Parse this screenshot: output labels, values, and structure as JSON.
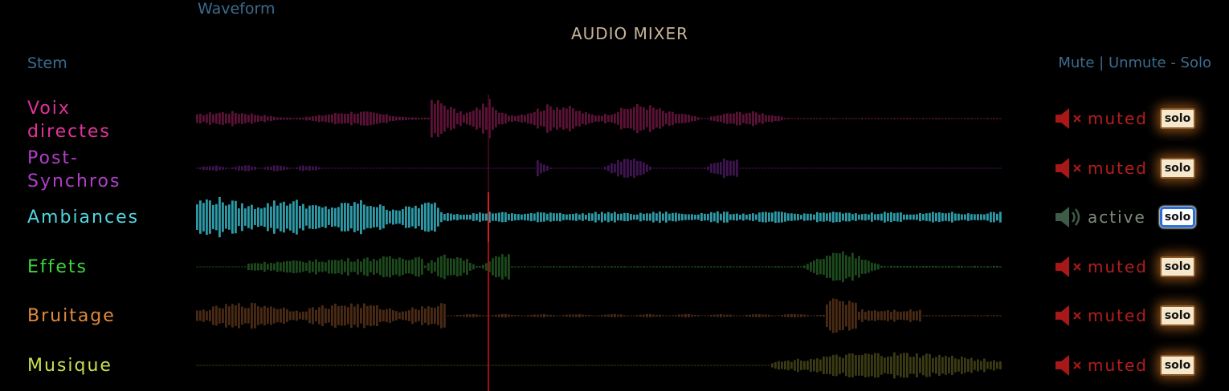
{
  "title": "AUDIO MIXER",
  "headers": {
    "stem": "Stem",
    "waveform": "Waveform",
    "controls": "Mute | Unmute - Solo"
  },
  "stems": [
    {
      "name": "Voix directes",
      "color": "#e0339a",
      "wave_color": "#5a1236",
      "status": "muted",
      "solo": "solo",
      "solo_on": false
    },
    {
      "name": "Post-Synchros",
      "color": "#b03ec8",
      "wave_color": "#3e1450",
      "status": "muted",
      "solo": "solo",
      "solo_on": false
    },
    {
      "name": "Ambiances",
      "color": "#4fd6e0",
      "wave_color": "#2e9aa8",
      "status": "active",
      "solo": "solo",
      "solo_on": true
    },
    {
      "name": "Effets",
      "color": "#3ed63e",
      "wave_color": "#1c4a1c",
      "status": "muted",
      "solo": "solo",
      "solo_on": false
    },
    {
      "name": "Bruitage",
      "color": "#e08a3e",
      "wave_color": "#4a2a14",
      "status": "muted",
      "solo": "solo",
      "solo_on": false
    },
    {
      "name": "Musique",
      "color": "#c8e050",
      "wave_color": "#3a3a14",
      "status": "muted",
      "solo": "solo",
      "solo_on": false
    }
  ],
  "icons": {
    "muted": "speaker-muted-icon",
    "active": "speaker-active-icon"
  },
  "playhead_fraction": 0.363
}
